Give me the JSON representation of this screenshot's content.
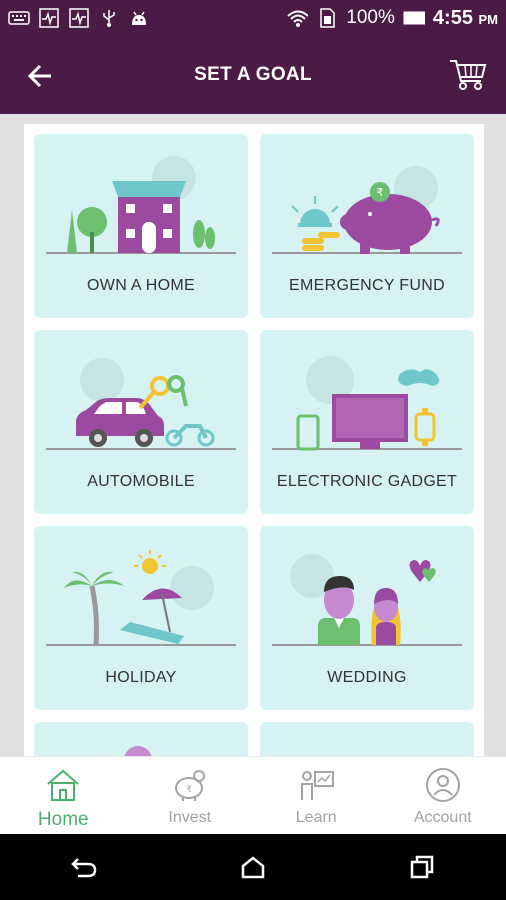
{
  "status_bar": {
    "battery": "100%",
    "time": "4:55",
    "ampm": "PM"
  },
  "app_bar": {
    "title": "SET A GOAL"
  },
  "goals": [
    {
      "label": "OWN A HOME",
      "icon": "house-icon"
    },
    {
      "label": "EMERGENCY FUND",
      "icon": "piggy-bank-icon"
    },
    {
      "label": "AUTOMOBILE",
      "icon": "car-icon"
    },
    {
      "label": "ELECTRONIC GADGET",
      "icon": "tv-icon"
    },
    {
      "label": "HOLIDAY",
      "icon": "beach-icon"
    },
    {
      "label": "WEDDING",
      "icon": "couple-icon"
    }
  ],
  "bottom_nav": [
    {
      "label": "Home",
      "icon": "home-icon",
      "active": true
    },
    {
      "label": "Invest",
      "icon": "invest-icon",
      "active": false
    },
    {
      "label": "Learn",
      "icon": "learn-icon",
      "active": false
    },
    {
      "label": "Account",
      "icon": "account-icon",
      "active": false
    }
  ],
  "colors": {
    "brand": "#4b1a45",
    "card": "#d6f2f3",
    "purple": "#a84fa6",
    "green": "#4caf70"
  }
}
